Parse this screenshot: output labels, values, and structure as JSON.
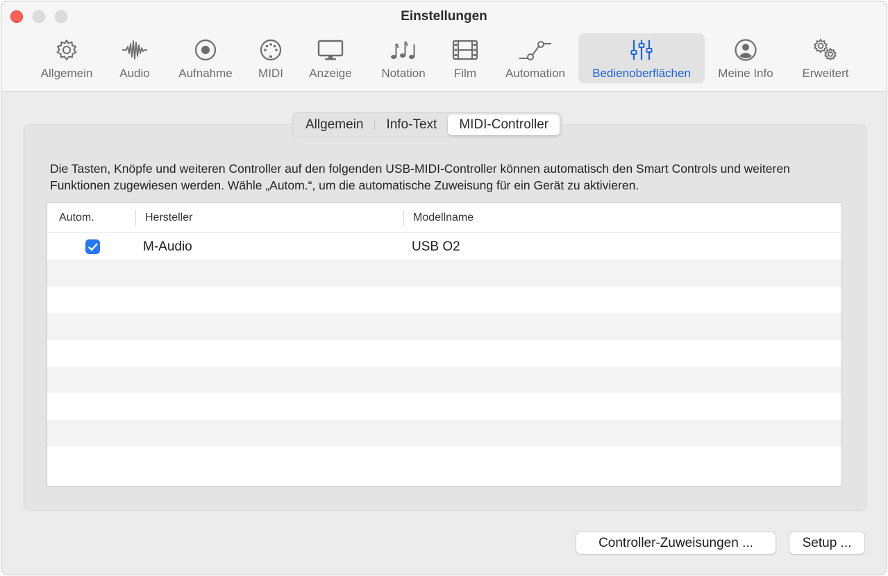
{
  "window": {
    "title": "Einstellungen"
  },
  "toolbar": {
    "items": [
      {
        "label": "Allgemein",
        "icon": "gear-icon"
      },
      {
        "label": "Audio",
        "icon": "waveform-icon"
      },
      {
        "label": "Aufnahme",
        "icon": "record-icon"
      },
      {
        "label": "MIDI",
        "icon": "midi-port-icon"
      },
      {
        "label": "Anzeige",
        "icon": "display-icon"
      },
      {
        "label": "Notation",
        "icon": "music-notes-icon"
      },
      {
        "label": "Film",
        "icon": "film-icon"
      },
      {
        "label": "Automation",
        "icon": "automation-icon"
      },
      {
        "label": "Bedienoberflächen",
        "icon": "sliders-icon"
      },
      {
        "label": "Meine Info",
        "icon": "person-icon"
      },
      {
        "label": "Erweitert",
        "icon": "gears-icon"
      }
    ],
    "active": "Bedienoberflächen",
    "accent": "#1a63e0"
  },
  "tabs": {
    "items": [
      "Allgemein",
      "Info-Text",
      "MIDI-Controller"
    ],
    "selected": "MIDI-Controller"
  },
  "description": "Die Tasten, Knöpfe und weiteren Controller auf den folgenden USB-MIDI-Controller können automatisch den Smart Controls und weiteren Funktionen zugewiesen werden. Wähle „Autom.“, um die automatische Zuweisung für ein Gerät zu aktivieren.",
  "table": {
    "columns": [
      "Autom.",
      "Hersteller",
      "Modellname"
    ],
    "rows": [
      {
        "auto": true,
        "manufacturer": "M-Audio",
        "model": "USB O2"
      }
    ]
  },
  "buttons": {
    "controller_assignments": "Controller-Zuweisungen ...",
    "setup": "Setup ..."
  }
}
